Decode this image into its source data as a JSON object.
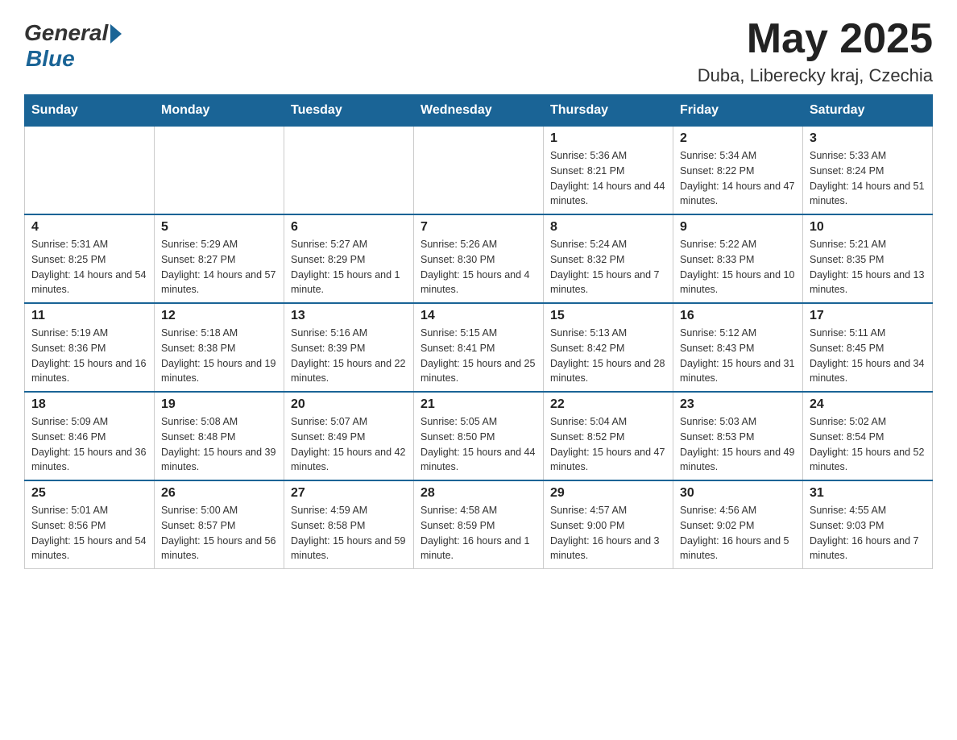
{
  "header": {
    "logo": {
      "general": "General",
      "blue": "Blue"
    },
    "title": "May 2025",
    "location": "Duba, Liberecky kraj, Czechia"
  },
  "days_of_week": [
    "Sunday",
    "Monday",
    "Tuesday",
    "Wednesday",
    "Thursday",
    "Friday",
    "Saturday"
  ],
  "weeks": [
    {
      "days": [
        {
          "num": "",
          "info": ""
        },
        {
          "num": "",
          "info": ""
        },
        {
          "num": "",
          "info": ""
        },
        {
          "num": "",
          "info": ""
        },
        {
          "num": "1",
          "info": "Sunrise: 5:36 AM\nSunset: 8:21 PM\nDaylight: 14 hours and 44 minutes."
        },
        {
          "num": "2",
          "info": "Sunrise: 5:34 AM\nSunset: 8:22 PM\nDaylight: 14 hours and 47 minutes."
        },
        {
          "num": "3",
          "info": "Sunrise: 5:33 AM\nSunset: 8:24 PM\nDaylight: 14 hours and 51 minutes."
        }
      ]
    },
    {
      "days": [
        {
          "num": "4",
          "info": "Sunrise: 5:31 AM\nSunset: 8:25 PM\nDaylight: 14 hours and 54 minutes."
        },
        {
          "num": "5",
          "info": "Sunrise: 5:29 AM\nSunset: 8:27 PM\nDaylight: 14 hours and 57 minutes."
        },
        {
          "num": "6",
          "info": "Sunrise: 5:27 AM\nSunset: 8:29 PM\nDaylight: 15 hours and 1 minute."
        },
        {
          "num": "7",
          "info": "Sunrise: 5:26 AM\nSunset: 8:30 PM\nDaylight: 15 hours and 4 minutes."
        },
        {
          "num": "8",
          "info": "Sunrise: 5:24 AM\nSunset: 8:32 PM\nDaylight: 15 hours and 7 minutes."
        },
        {
          "num": "9",
          "info": "Sunrise: 5:22 AM\nSunset: 8:33 PM\nDaylight: 15 hours and 10 minutes."
        },
        {
          "num": "10",
          "info": "Sunrise: 5:21 AM\nSunset: 8:35 PM\nDaylight: 15 hours and 13 minutes."
        }
      ]
    },
    {
      "days": [
        {
          "num": "11",
          "info": "Sunrise: 5:19 AM\nSunset: 8:36 PM\nDaylight: 15 hours and 16 minutes."
        },
        {
          "num": "12",
          "info": "Sunrise: 5:18 AM\nSunset: 8:38 PM\nDaylight: 15 hours and 19 minutes."
        },
        {
          "num": "13",
          "info": "Sunrise: 5:16 AM\nSunset: 8:39 PM\nDaylight: 15 hours and 22 minutes."
        },
        {
          "num": "14",
          "info": "Sunrise: 5:15 AM\nSunset: 8:41 PM\nDaylight: 15 hours and 25 minutes."
        },
        {
          "num": "15",
          "info": "Sunrise: 5:13 AM\nSunset: 8:42 PM\nDaylight: 15 hours and 28 minutes."
        },
        {
          "num": "16",
          "info": "Sunrise: 5:12 AM\nSunset: 8:43 PM\nDaylight: 15 hours and 31 minutes."
        },
        {
          "num": "17",
          "info": "Sunrise: 5:11 AM\nSunset: 8:45 PM\nDaylight: 15 hours and 34 minutes."
        }
      ]
    },
    {
      "days": [
        {
          "num": "18",
          "info": "Sunrise: 5:09 AM\nSunset: 8:46 PM\nDaylight: 15 hours and 36 minutes."
        },
        {
          "num": "19",
          "info": "Sunrise: 5:08 AM\nSunset: 8:48 PM\nDaylight: 15 hours and 39 minutes."
        },
        {
          "num": "20",
          "info": "Sunrise: 5:07 AM\nSunset: 8:49 PM\nDaylight: 15 hours and 42 minutes."
        },
        {
          "num": "21",
          "info": "Sunrise: 5:05 AM\nSunset: 8:50 PM\nDaylight: 15 hours and 44 minutes."
        },
        {
          "num": "22",
          "info": "Sunrise: 5:04 AM\nSunset: 8:52 PM\nDaylight: 15 hours and 47 minutes."
        },
        {
          "num": "23",
          "info": "Sunrise: 5:03 AM\nSunset: 8:53 PM\nDaylight: 15 hours and 49 minutes."
        },
        {
          "num": "24",
          "info": "Sunrise: 5:02 AM\nSunset: 8:54 PM\nDaylight: 15 hours and 52 minutes."
        }
      ]
    },
    {
      "days": [
        {
          "num": "25",
          "info": "Sunrise: 5:01 AM\nSunset: 8:56 PM\nDaylight: 15 hours and 54 minutes."
        },
        {
          "num": "26",
          "info": "Sunrise: 5:00 AM\nSunset: 8:57 PM\nDaylight: 15 hours and 56 minutes."
        },
        {
          "num": "27",
          "info": "Sunrise: 4:59 AM\nSunset: 8:58 PM\nDaylight: 15 hours and 59 minutes."
        },
        {
          "num": "28",
          "info": "Sunrise: 4:58 AM\nSunset: 8:59 PM\nDaylight: 16 hours and 1 minute."
        },
        {
          "num": "29",
          "info": "Sunrise: 4:57 AM\nSunset: 9:00 PM\nDaylight: 16 hours and 3 minutes."
        },
        {
          "num": "30",
          "info": "Sunrise: 4:56 AM\nSunset: 9:02 PM\nDaylight: 16 hours and 5 minutes."
        },
        {
          "num": "31",
          "info": "Sunrise: 4:55 AM\nSunset: 9:03 PM\nDaylight: 16 hours and 7 minutes."
        }
      ]
    }
  ]
}
